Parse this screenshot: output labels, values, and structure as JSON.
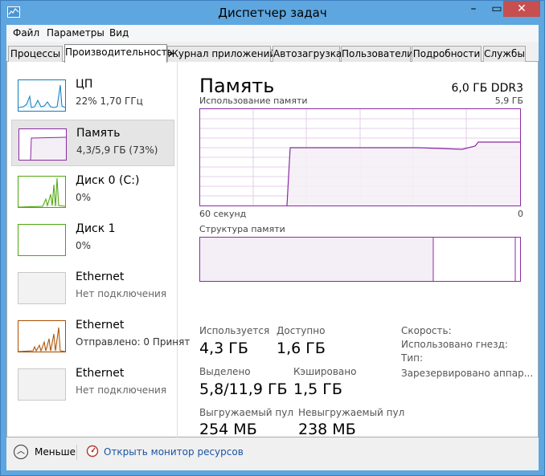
{
  "window": {
    "title": "Диспетчер задач",
    "controls": {
      "minimize": "–",
      "maximize": "▭",
      "close": "✕"
    }
  },
  "menu": {
    "file": "Файл",
    "params": "Параметры",
    "view": "Вид"
  },
  "tabs": [
    {
      "label": "Процессы"
    },
    {
      "label": "Производительность"
    },
    {
      "label": "Журнал приложений"
    },
    {
      "label": "Автозагрузка"
    },
    {
      "label": "Пользователи"
    },
    {
      "label": "Подробности"
    },
    {
      "label": "Службы"
    }
  ],
  "sidebar": [
    {
      "name": "ЦП",
      "sub": "22%  1,70 ГГц"
    },
    {
      "name": "Память",
      "sub": "4,3/5,9 ГБ (73%)"
    },
    {
      "name": "Диск 0 (C:)",
      "sub": "0%"
    },
    {
      "name": "Диск 1",
      "sub": "0%"
    },
    {
      "name": "Ethernet",
      "sub": "Нет подключения"
    },
    {
      "name": "Ethernet",
      "sub": "Отправлено: 0 Принят"
    },
    {
      "name": "Ethernet",
      "sub": "Нет подключения"
    }
  ],
  "main": {
    "title": "Память",
    "spec": "6,0 ГБ DDR3",
    "usage_label": "Использование памяти",
    "usage_max": "5,9 ГБ",
    "axis_left": "60 секунд",
    "axis_right": "0",
    "structure_label": "Структура памяти",
    "stats": {
      "used_label": "Используется",
      "used_value": "4,3 ГБ",
      "avail_label": "Доступно",
      "avail_value": "1,6 ГБ",
      "committed_label": "Выделено",
      "committed_value": "5,8/11,9 ГБ",
      "cached_label": "Кэшировано",
      "cached_value": "1,5 ГБ",
      "paged_label": "Выгружаемый пул",
      "paged_value": "254 МБ",
      "nonpaged_label": "Невыгружаемый пул",
      "nonpaged_value": "238 МБ"
    },
    "right": {
      "speed": "Скорость:",
      "slots": "Использовано гнезд:",
      "form": "Тип:",
      "reserved": "Зарезервировано аппар..."
    }
  },
  "footer": {
    "less": "Меньше",
    "monitor": "Открыть монитор ресурсов"
  },
  "colors": {
    "memory": "#8b2ba3",
    "memory_fill": "#f4eef6",
    "cpu": "#117dbb",
    "disk": "#4da60c",
    "ethernet": "#a74f01"
  }
}
